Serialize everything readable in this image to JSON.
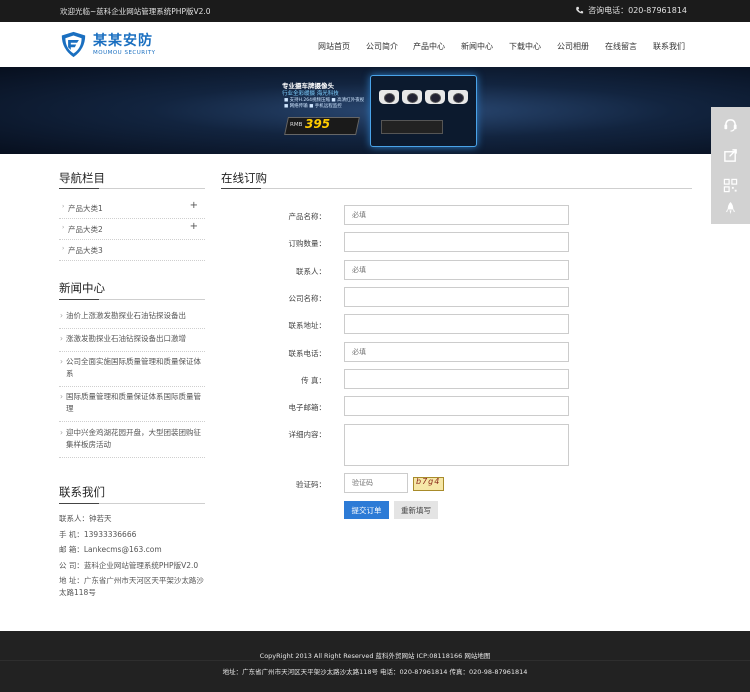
{
  "topbar": {
    "welcome": "欢迎光临~蓝科企业网站管理系统PHP版V2.0",
    "phone": "咨询电话：020-87961814"
  },
  "logo": {
    "name_cn": "某某安防",
    "name_en": "MOUMOU  SECURITY"
  },
  "nav": [
    "网站首页",
    "公司简介",
    "产品中心",
    "新闻中心",
    "下载中心",
    "公司相册",
    "在线留言",
    "联系我们"
  ],
  "banner": {
    "title": "专业摄车牌摄像头",
    "subtitle": "行业全彩缓摄 海光科技",
    "features": [
      "■ 支持H.264视频压缩 ■ 高清红外夜视",
      "■ 网络传输 ■ 手机远程监控"
    ],
    "currency": "RMB",
    "price": "395"
  },
  "sidebar": {
    "nav_title": "导航栏目",
    "nav_items": [
      {
        "label": "产品大类1",
        "expand": "+"
      },
      {
        "label": "产品大类2",
        "expand": "+"
      },
      {
        "label": "产品大类3",
        "expand": ""
      }
    ],
    "news_title": "新闻中心",
    "news_items": [
      "油价上涨激发勘探业石油钻探设备出",
      "涨激发勘探业石油钻探设备出口激增",
      "公司全面实施国际质量管理和质量保证体系",
      "国际质量管理和质量保证体系国际质量管理",
      "迎中兴金鸡湖花园开盘，大型团装团购征集样板房活动"
    ],
    "contact_title": "联系我们",
    "contact_lines": [
      "联系人：钟若天",
      "手 机：13933336666",
      "邮 箱：Lankecms@163.com",
      "公 司：蓝科企业网站管理系统PHP版V2.0",
      "地 址：广东省广州市天河区天平架沙太路沙太路118号"
    ]
  },
  "main": {
    "title": "在线订购",
    "fields": [
      {
        "label": "产品名称：",
        "placeholder": "必填",
        "type": "input"
      },
      {
        "label": "订购数量：",
        "placeholder": "",
        "type": "input"
      },
      {
        "label": "联系人：",
        "placeholder": "必填",
        "type": "input"
      },
      {
        "label": "公司名称：",
        "placeholder": "",
        "type": "input"
      },
      {
        "label": "联系地址：",
        "placeholder": "",
        "type": "input"
      },
      {
        "label": "联系电话：",
        "placeholder": "必填",
        "type": "input"
      },
      {
        "label": "传 真：",
        "placeholder": "",
        "type": "input"
      },
      {
        "label": "电子邮箱：",
        "placeholder": "",
        "type": "input"
      },
      {
        "label": "详细内容：",
        "placeholder": "",
        "type": "textarea"
      }
    ],
    "captcha": {
      "label": "验证码：",
      "placeholder": "验证码",
      "image_text": "b7g4"
    },
    "submit_label": "提交订单",
    "reset_label": "重新填写"
  },
  "footer": {
    "line1": "CopyRight 2013 All Right Reserved 蓝科外贸网站 ICP:08118166 网站地图",
    "line2": "地址：广东省广州市天河区天平架沙太路沙太路118号  电话：020-87961814  传真：020-98-87961814"
  },
  "colors": {
    "accent": "#2d7bd6",
    "topbar": "#1b1b1b",
    "footer": "#222222",
    "logo": "#1a6fc0"
  }
}
